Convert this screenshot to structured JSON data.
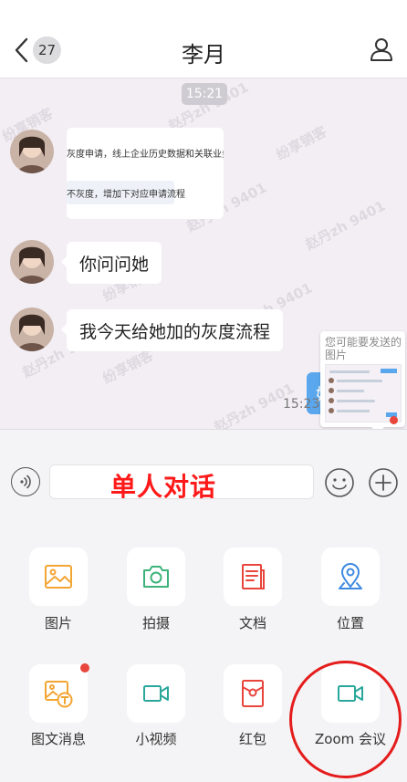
{
  "header": {
    "back_badge": "27",
    "title": "李月"
  },
  "chat": {
    "time_pill": "15:21",
    "card_line1": "灰度申请，线上企业历史数据和关联业务比较",
    "card_line2": "不灰度，增加下对应申请流程",
    "msg1": "你问问她",
    "msg2": "我今天给她加的灰度流程",
    "sent_first_char": "好",
    "sent_time": "15:23",
    "watermark_name": "赵丹zh 9401",
    "watermark_app": "纷享销客"
  },
  "popup": {
    "text": "您可能要发送的图片"
  },
  "input": {
    "annotation": "单人对话"
  },
  "panel": {
    "items": [
      {
        "label": "图片",
        "icon": "image-icon"
      },
      {
        "label": "拍摄",
        "icon": "camera-icon"
      },
      {
        "label": "文档",
        "icon": "document-icon"
      },
      {
        "label": "位置",
        "icon": "location-icon"
      },
      {
        "label": "图文消息",
        "icon": "image-text-icon"
      },
      {
        "label": "小视频",
        "icon": "video-icon"
      },
      {
        "label": "红包",
        "icon": "red-packet-icon"
      },
      {
        "label": "Zoom 会议",
        "icon": "zoom-meeting-icon"
      }
    ]
  },
  "colors": {
    "orange": "#f3a533",
    "green": "#3db37a",
    "red": "#e8453c",
    "blue": "#3f8ae0",
    "teal": "#2aa79b",
    "sent_bubble": "#5aa7ee",
    "annotation": "#ff1a1a"
  }
}
